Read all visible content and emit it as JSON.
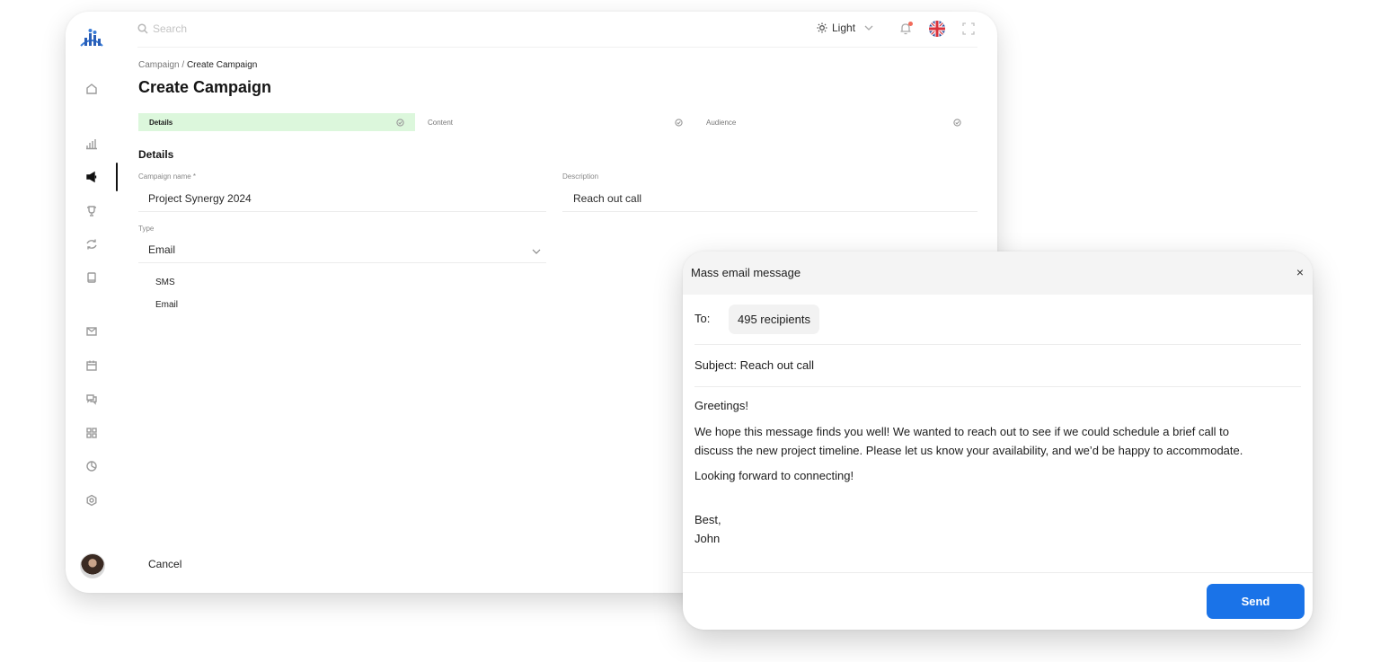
{
  "topbar": {
    "search_placeholder": "Search",
    "theme_label": "Light"
  },
  "breadcrumb": {
    "parent": "Campaign",
    "separator": "/",
    "current": "Create Campaign"
  },
  "page_title": "Create Campaign",
  "steps": [
    {
      "label": "Details",
      "active": true
    },
    {
      "label": "Content",
      "active": false
    },
    {
      "label": "Audience",
      "active": false
    }
  ],
  "details": {
    "section_title": "Details",
    "campaign_name_label": "Campaign name *",
    "campaign_name_value": "Project Synergy 2024",
    "description_label": "Description",
    "description_value": "Reach out call",
    "type_label": "Type",
    "type_value": "Email",
    "type_options": [
      "SMS",
      "Email"
    ]
  },
  "cancel_label": "Cancel",
  "modal": {
    "title": "Mass email message",
    "close_glyph": "×",
    "to_label": "To:",
    "recipients": "495 recipients",
    "subject": "Subject: Reach out call",
    "body": {
      "greeting": "Greetings!",
      "line1": "We hope this message finds you well! We wanted to reach out to see if we could schedule a brief call to",
      "line2": "discuss the new project timeline. Please let us know your availability, and we’d be happy to accommodate.",
      "line3": "Looking forward to connecting!",
      "signoff": "Best,",
      "name": "John"
    },
    "send_label": "Send"
  },
  "colors": {
    "active_step_bg": "#dcf7dc",
    "send_button": "#1a73e8",
    "notification_dot": "#f26b5b"
  },
  "icons": [
    "logo-icon",
    "home-icon",
    "chart-icon",
    "megaphone-icon",
    "trophy-icon",
    "refresh-icon",
    "book-icon",
    "mail-icon",
    "calendar-icon",
    "chat-icon",
    "grid-icon",
    "pie-icon",
    "settings-icon",
    "search-icon",
    "sun-icon",
    "bell-icon",
    "uk-flag-icon",
    "fullscreen-icon",
    "check-circle-icon",
    "chevron-down-icon",
    "close-icon"
  ]
}
